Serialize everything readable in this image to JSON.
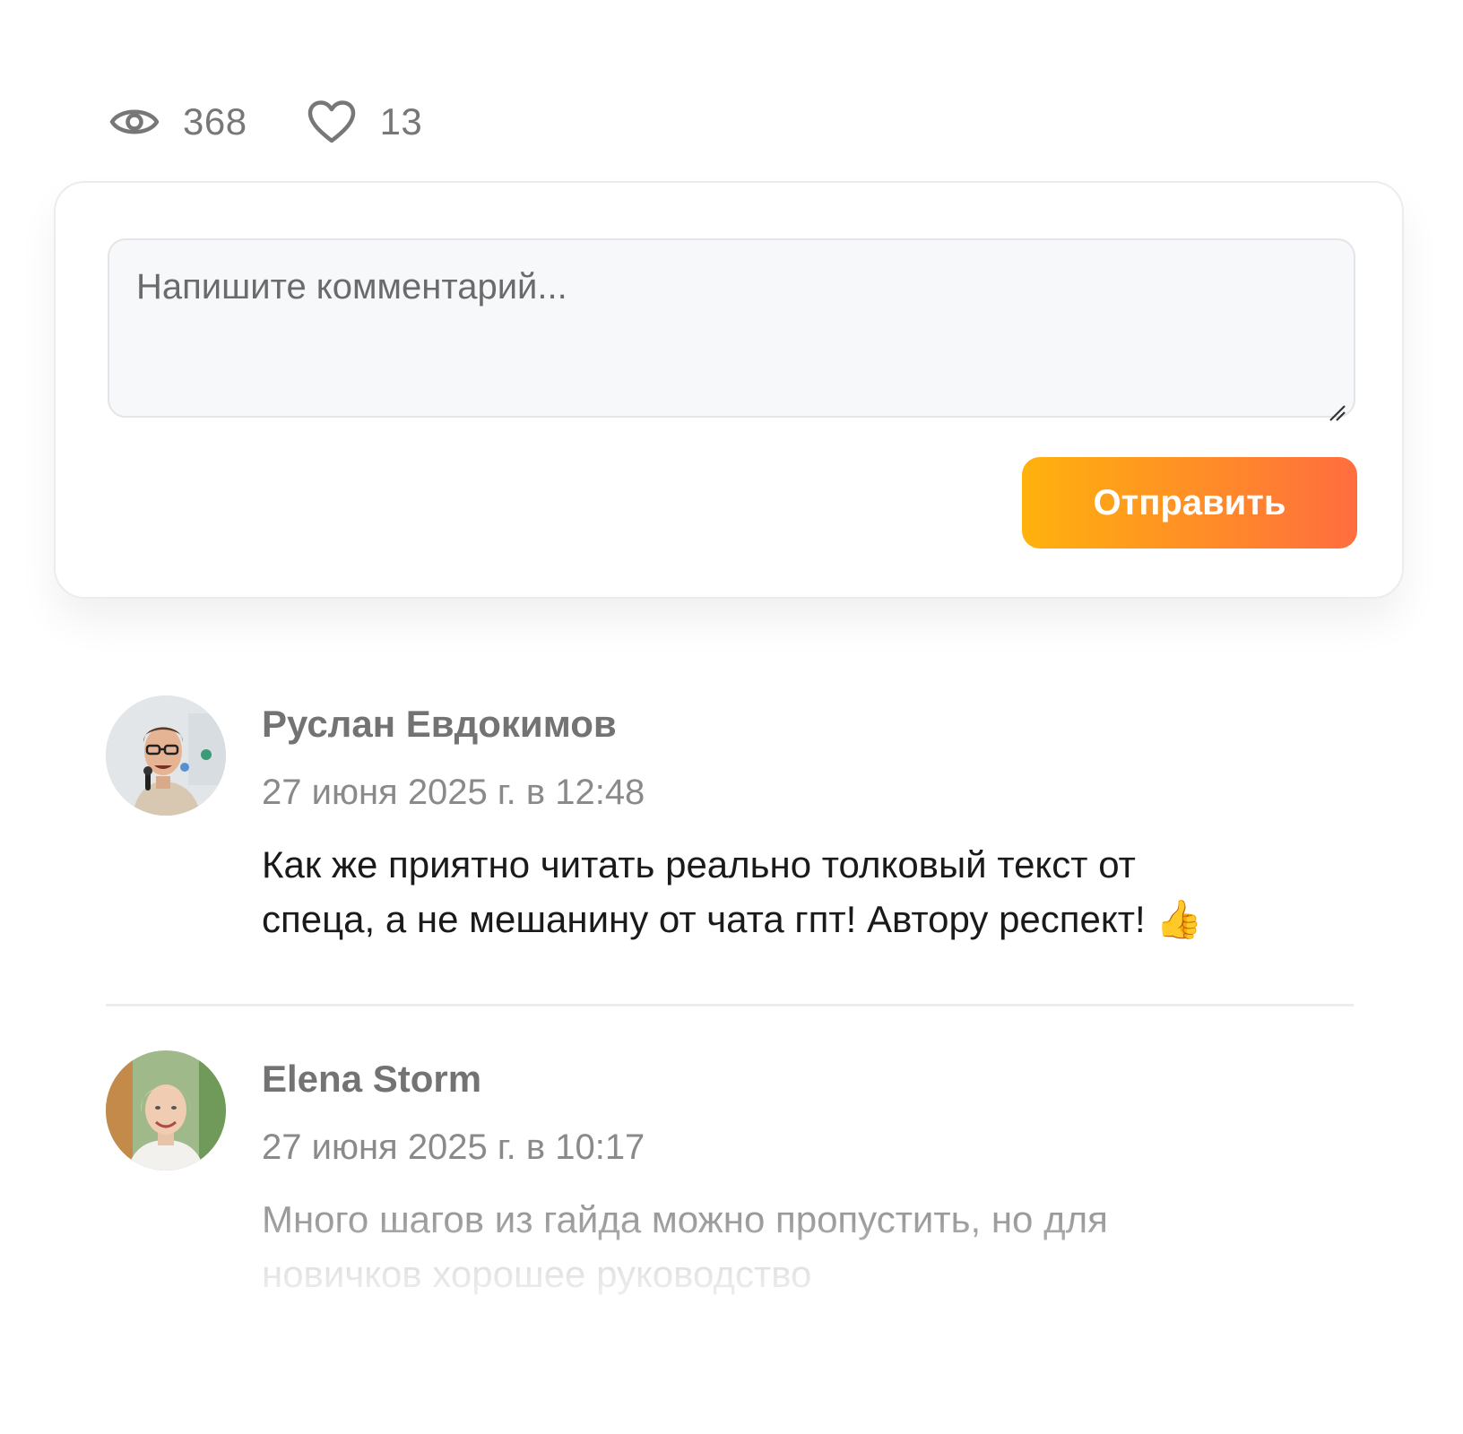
{
  "stats": {
    "views_icon": "eye-icon",
    "views": "368",
    "likes_icon": "heart-icon",
    "likes": "13"
  },
  "comment_form": {
    "placeholder": "Напишите комментарий...",
    "submit_label": "Отправить",
    "button_gradient": [
      "#ffb20c",
      "#ff6d3f"
    ]
  },
  "comments": [
    {
      "author": "Руслан Евдокимов",
      "date": "27 июня 2025 г. в 12:48",
      "text_line1": "Как же приятно читать реально толковый текст от",
      "text_line2": "спеца, а не мешанину от чата гпт! Автору респект!",
      "emoji": "👍"
    },
    {
      "author": "Elena Storm",
      "date": "27 июня 2025 г. в 10:17",
      "text_line1": "Много шагов из гайда можно пропустить, но для",
      "text_line2": "новичков хорошее руководство"
    }
  ]
}
